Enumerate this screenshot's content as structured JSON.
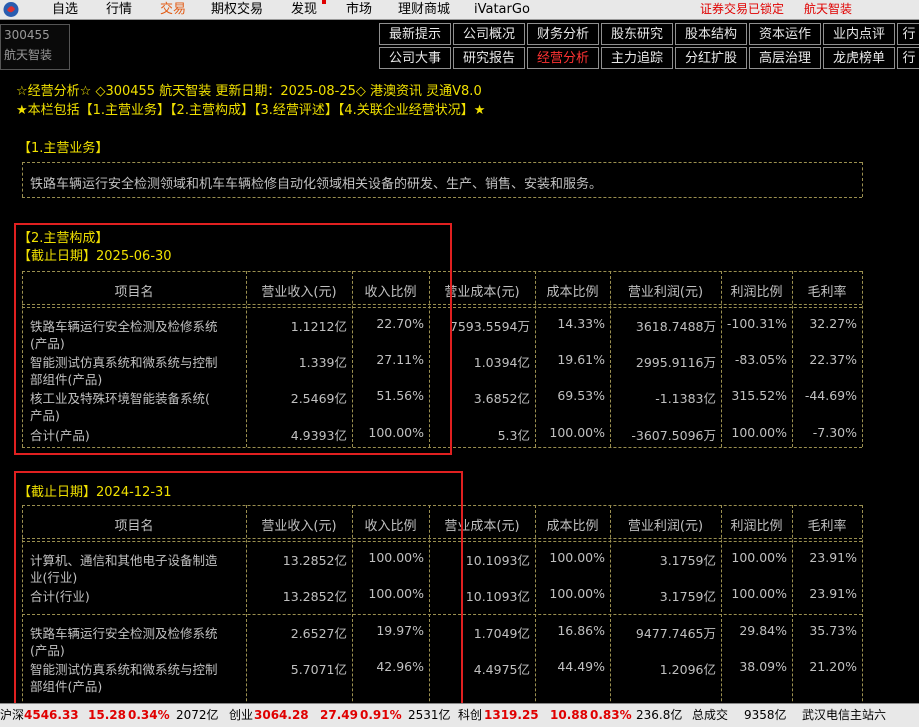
{
  "menu": {
    "items": [
      {
        "label": "自选",
        "active": false
      },
      {
        "label": "行情",
        "active": false
      },
      {
        "label": "交易",
        "active": true
      },
      {
        "label": "期权交易",
        "active": false
      },
      {
        "label": "发现",
        "active": false
      },
      {
        "label": "市场",
        "active": false
      },
      {
        "label": "理财商城",
        "active": false
      },
      {
        "label": "iVatarGo",
        "active": false
      }
    ],
    "right_status": "证券交易已锁定",
    "right_stock": "航天智装"
  },
  "stock": {
    "code": "300455",
    "name": "航天智装"
  },
  "tabs": {
    "row1": [
      "最新提示",
      "公司概况",
      "财务分析",
      "股东研究",
      "股本结构",
      "资本运作",
      "业内点评",
      "行"
    ],
    "row2": [
      "公司大事",
      "研究报告",
      "经营分析",
      "主力追踪",
      "分红扩股",
      "高层治理",
      "龙虎榜单",
      "行"
    ],
    "active": "经营分析"
  },
  "header": {
    "line1": "☆经营分析☆ ◇300455 航天智装 更新日期：2025-08-25◇ 港澳资讯 灵通V8.0",
    "line2": "★本栏包括【1.主营业务】【2.主营构成】【3.经营评述】【4.关联企业经营状况】★"
  },
  "section1": {
    "title": "【1.主营业务】",
    "text": "铁路车辆运行安全检测领域和机车车辆检修自动化领域相关设备的研发、生产、销售、安装和服务。"
  },
  "section2": {
    "title": "【2.主营构成】",
    "columns": [
      "项目名",
      "营业收入(元)",
      "收入比例",
      "营业成本(元)",
      "成本比例",
      "营业利润(元)",
      "利润比例",
      "毛利率"
    ],
    "period1": {
      "label": "【截止日期】2025-06-30",
      "rows": [
        {
          "name": [
            "铁路车辆运行安全检测及检修系统",
            "(产品)"
          ],
          "rev": "1.1212亿",
          "rev_pct": "22.70%",
          "cost": "7593.5594万",
          "cost_pct": "14.33%",
          "profit": "3618.7488万",
          "profit_pct": "-100.31%",
          "margin": "32.27%"
        },
        {
          "name": [
            "智能测试仿真系统和微系统与控制",
            "部组件(产品)"
          ],
          "rev": "1.339亿",
          "rev_pct": "27.11%",
          "cost": "1.0394亿",
          "cost_pct": "19.61%",
          "profit": "2995.9116万",
          "profit_pct": "-83.05%",
          "margin": "22.37%"
        },
        {
          "name": [
            "核工业及特殊环境智能装备系统(",
            "产品)"
          ],
          "rev": "2.5469亿",
          "rev_pct": "51.56%",
          "cost": "3.6852亿",
          "cost_pct": "69.53%",
          "profit": "-1.1383亿",
          "profit_pct": "315.52%",
          "margin": "-44.69%"
        },
        {
          "name": [
            "合计(产品)"
          ],
          "rev": "4.9393亿",
          "rev_pct": "100.00%",
          "cost": "5.3亿",
          "cost_pct": "100.00%",
          "profit": "-3607.5096万",
          "profit_pct": "100.00%",
          "margin": "-7.30%"
        }
      ]
    },
    "period2": {
      "label": "【截止日期】2024-12-31",
      "rows": [
        {
          "name": [
            "计算机、通信和其他电子设备制造",
            "业(行业)"
          ],
          "rev": "13.2852亿",
          "rev_pct": "100.00%",
          "cost": "10.1093亿",
          "cost_pct": "100.00%",
          "profit": "3.1759亿",
          "profit_pct": "100.00%",
          "margin": "23.91%"
        },
        {
          "name": [
            "合计(行业)"
          ],
          "rev": "13.2852亿",
          "rev_pct": "100.00%",
          "cost": "10.1093亿",
          "cost_pct": "100.00%",
          "profit": "3.1759亿",
          "profit_pct": "100.00%",
          "margin": "23.91%"
        },
        {
          "name": [
            "铁路车辆运行安全检测及检修系统",
            "(产品)"
          ],
          "rev": "2.6527亿",
          "rev_pct": "19.97%",
          "cost": "1.7049亿",
          "cost_pct": "16.86%",
          "profit": "9477.7465万",
          "profit_pct": "29.84%",
          "margin": "35.73%"
        },
        {
          "name": [
            "智能测试仿真系统和微系统与控制",
            "部组件(产品)"
          ],
          "rev": "5.7071亿",
          "rev_pct": "42.96%",
          "cost": "4.4975亿",
          "cost_pct": "44.49%",
          "profit": "1.2096亿",
          "profit_pct": "38.09%",
          "margin": "21.20%"
        }
      ]
    }
  },
  "statusbar": {
    "sh_label": "沪深",
    "sh_val": "4546.33",
    "sh_chg": "15.28",
    "sh_pct": "0.34%",
    "sh_amt": "2072亿",
    "cy_label": "创业",
    "cy_val": "3064.28",
    "cy_chg": "27.49",
    "cy_pct": "0.91%",
    "cy_amt": "2531亿",
    "kc_label": "科创",
    "kc_val": "1319.25",
    "kc_chg": "10.88",
    "kc_pct": "0.83%",
    "kc_amt": "236.8亿",
    "total_label": "总成交",
    "total_amt": "9358亿",
    "ticker": "武汉电信主站六"
  },
  "colors": {
    "accent_red": "#e02020",
    "text_yellow": "#f0e000",
    "active_menu": "#e25c16"
  }
}
